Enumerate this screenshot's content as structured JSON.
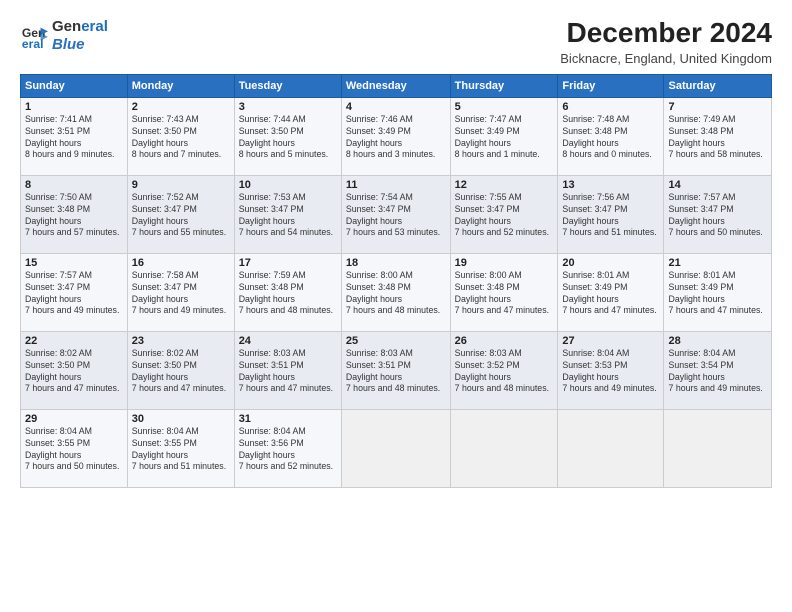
{
  "logo": {
    "line1": "General",
    "line2": "Blue"
  },
  "title": "December 2024",
  "subtitle": "Bicknacre, England, United Kingdom",
  "weekdays": [
    "Sunday",
    "Monday",
    "Tuesday",
    "Wednesday",
    "Thursday",
    "Friday",
    "Saturday"
  ],
  "weeks": [
    [
      {
        "day": "1",
        "sunrise": "7:41 AM",
        "sunset": "3:51 PM",
        "daylight": "8 hours and 9 minutes."
      },
      {
        "day": "2",
        "sunrise": "7:43 AM",
        "sunset": "3:50 PM",
        "daylight": "8 hours and 7 minutes."
      },
      {
        "day": "3",
        "sunrise": "7:44 AM",
        "sunset": "3:50 PM",
        "daylight": "8 hours and 5 minutes."
      },
      {
        "day": "4",
        "sunrise": "7:46 AM",
        "sunset": "3:49 PM",
        "daylight": "8 hours and 3 minutes."
      },
      {
        "day": "5",
        "sunrise": "7:47 AM",
        "sunset": "3:49 PM",
        "daylight": "8 hours and 1 minute."
      },
      {
        "day": "6",
        "sunrise": "7:48 AM",
        "sunset": "3:48 PM",
        "daylight": "8 hours and 0 minutes."
      },
      {
        "day": "7",
        "sunrise": "7:49 AM",
        "sunset": "3:48 PM",
        "daylight": "7 hours and 58 minutes."
      }
    ],
    [
      {
        "day": "8",
        "sunrise": "7:50 AM",
        "sunset": "3:48 PM",
        "daylight": "7 hours and 57 minutes."
      },
      {
        "day": "9",
        "sunrise": "7:52 AM",
        "sunset": "3:47 PM",
        "daylight": "7 hours and 55 minutes."
      },
      {
        "day": "10",
        "sunrise": "7:53 AM",
        "sunset": "3:47 PM",
        "daylight": "7 hours and 54 minutes."
      },
      {
        "day": "11",
        "sunrise": "7:54 AM",
        "sunset": "3:47 PM",
        "daylight": "7 hours and 53 minutes."
      },
      {
        "day": "12",
        "sunrise": "7:55 AM",
        "sunset": "3:47 PM",
        "daylight": "7 hours and 52 minutes."
      },
      {
        "day": "13",
        "sunrise": "7:56 AM",
        "sunset": "3:47 PM",
        "daylight": "7 hours and 51 minutes."
      },
      {
        "day": "14",
        "sunrise": "7:57 AM",
        "sunset": "3:47 PM",
        "daylight": "7 hours and 50 minutes."
      }
    ],
    [
      {
        "day": "15",
        "sunrise": "7:57 AM",
        "sunset": "3:47 PM",
        "daylight": "7 hours and 49 minutes."
      },
      {
        "day": "16",
        "sunrise": "7:58 AM",
        "sunset": "3:47 PM",
        "daylight": "7 hours and 49 minutes."
      },
      {
        "day": "17",
        "sunrise": "7:59 AM",
        "sunset": "3:48 PM",
        "daylight": "7 hours and 48 minutes."
      },
      {
        "day": "18",
        "sunrise": "8:00 AM",
        "sunset": "3:48 PM",
        "daylight": "7 hours and 48 minutes."
      },
      {
        "day": "19",
        "sunrise": "8:00 AM",
        "sunset": "3:48 PM",
        "daylight": "7 hours and 47 minutes."
      },
      {
        "day": "20",
        "sunrise": "8:01 AM",
        "sunset": "3:49 PM",
        "daylight": "7 hours and 47 minutes."
      },
      {
        "day": "21",
        "sunrise": "8:01 AM",
        "sunset": "3:49 PM",
        "daylight": "7 hours and 47 minutes."
      }
    ],
    [
      {
        "day": "22",
        "sunrise": "8:02 AM",
        "sunset": "3:50 PM",
        "daylight": "7 hours and 47 minutes."
      },
      {
        "day": "23",
        "sunrise": "8:02 AM",
        "sunset": "3:50 PM",
        "daylight": "7 hours and 47 minutes."
      },
      {
        "day": "24",
        "sunrise": "8:03 AM",
        "sunset": "3:51 PM",
        "daylight": "7 hours and 47 minutes."
      },
      {
        "day": "25",
        "sunrise": "8:03 AM",
        "sunset": "3:51 PM",
        "daylight": "7 hours and 48 minutes."
      },
      {
        "day": "26",
        "sunrise": "8:03 AM",
        "sunset": "3:52 PM",
        "daylight": "7 hours and 48 minutes."
      },
      {
        "day": "27",
        "sunrise": "8:04 AM",
        "sunset": "3:53 PM",
        "daylight": "7 hours and 49 minutes."
      },
      {
        "day": "28",
        "sunrise": "8:04 AM",
        "sunset": "3:54 PM",
        "daylight": "7 hours and 49 minutes."
      }
    ],
    [
      {
        "day": "29",
        "sunrise": "8:04 AM",
        "sunset": "3:55 PM",
        "daylight": "7 hours and 50 minutes."
      },
      {
        "day": "30",
        "sunrise": "8:04 AM",
        "sunset": "3:55 PM",
        "daylight": "7 hours and 51 minutes."
      },
      {
        "day": "31",
        "sunrise": "8:04 AM",
        "sunset": "3:56 PM",
        "daylight": "7 hours and 52 minutes."
      },
      null,
      null,
      null,
      null
    ]
  ]
}
